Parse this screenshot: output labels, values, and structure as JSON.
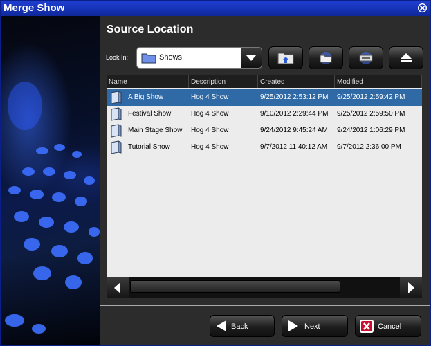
{
  "window": {
    "title": "Merge Show"
  },
  "panel": {
    "heading": "Source Location",
    "look_in_label": "Look In:",
    "look_in_value": "Shows"
  },
  "toolbar": {
    "buttons": [
      "up-folder-icon",
      "new-folder-icon",
      "network-drive-icon",
      "eject-icon"
    ]
  },
  "table": {
    "columns": [
      "Name",
      "Description",
      "Created",
      "Modified"
    ],
    "rows": [
      {
        "name": "A Big Show",
        "description": "Hog 4 Show",
        "created": "9/25/2012 2:53:12 PM",
        "modified": "9/25/2012 2:59:42 PM",
        "selected": true
      },
      {
        "name": "Festival Show",
        "description": "Hog 4 Show",
        "created": "9/10/2012 2:29:44 PM",
        "modified": "9/25/2012 2:59:50 PM",
        "selected": false
      },
      {
        "name": "Main Stage Show",
        "description": "Hog 4 Show",
        "created": "9/24/2012 9:45:24 AM",
        "modified": "9/24/2012 1:06:29 PM",
        "selected": false
      },
      {
        "name": "Tutorial Show",
        "description": "Hog 4 Show",
        "created": "9/7/2012 11:40:12 AM",
        "modified": "9/7/2012 2:36:00 PM",
        "selected": false
      }
    ]
  },
  "buttons": {
    "back": "Back",
    "next": "Next",
    "cancel": "Cancel"
  },
  "colors": {
    "title_bar": "#1532b5",
    "selection": "#2f6aa6",
    "cancel_icon": "#c8102e"
  }
}
